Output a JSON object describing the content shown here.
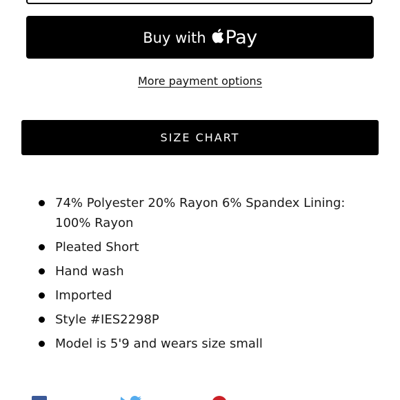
{
  "payment": {
    "applepay_prefix": "Buy with",
    "applepay_brand": "Pay",
    "more_options_label": "More payment options"
  },
  "size_chart": {
    "label": "SIZE CHART"
  },
  "features": [
    "74% Polyester 20% Rayon 6% Spandex   Lining: 100% Rayon",
    "Pleated Short",
    "Hand wash",
    "Imported",
    "Style #IES2298P",
    "Model is 5'9 and wears size small"
  ],
  "social": {
    "icons": [
      "facebook-icon",
      "twitter-icon",
      "pinterest-icon"
    ]
  },
  "colors": {
    "button_bg": "#000000",
    "button_text": "#ffffff",
    "facebook": "#3b5998",
    "twitter": "#55acee",
    "pinterest": "#cb2027"
  }
}
